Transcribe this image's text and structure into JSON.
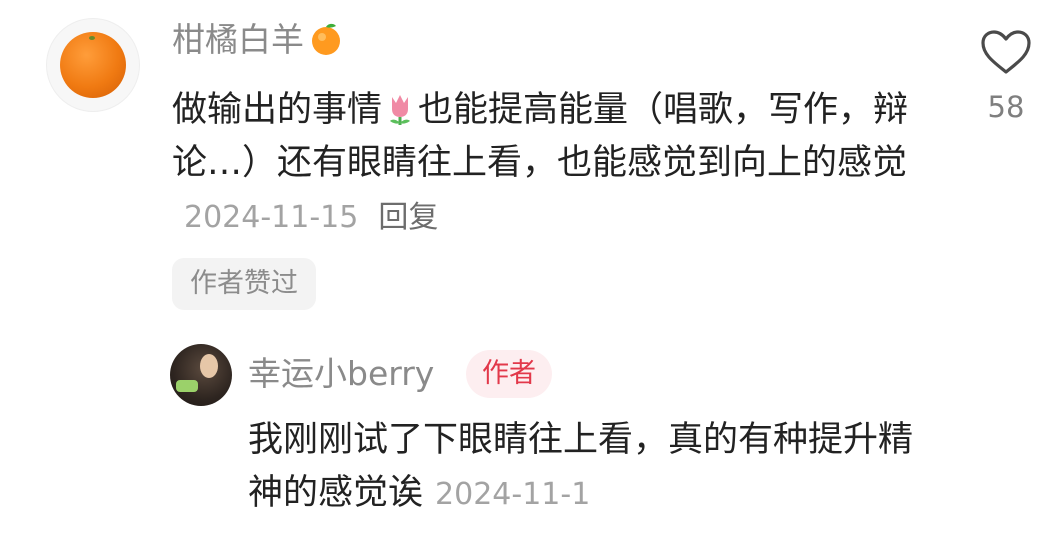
{
  "comment": {
    "username": "柑橘白羊",
    "username_emoji": "orange-emoji",
    "text_part1": "做输出的事情",
    "inline_emoji": "tulip-emoji",
    "text_part2": "也能提高能量（唱歌，写作，辩论…）还有眼睛往上看，也能感觉到向上的感觉",
    "date": "2024-11-15",
    "reply_label": "回复",
    "like_count": "58",
    "author_liked_label": "作者赞过"
  },
  "reply": {
    "username": "幸运小berry",
    "author_badge": "作者",
    "text": "我刚刚试了下眼睛往上看，真的有种提升精神的感觉诶",
    "date": "2024-11-1"
  },
  "colors": {
    "username": "#8a8a8a",
    "body_text": "#222222",
    "meta_text": "#a3a3a3",
    "badge_text": "#e2384a",
    "badge_bg": "#fdeef0"
  }
}
